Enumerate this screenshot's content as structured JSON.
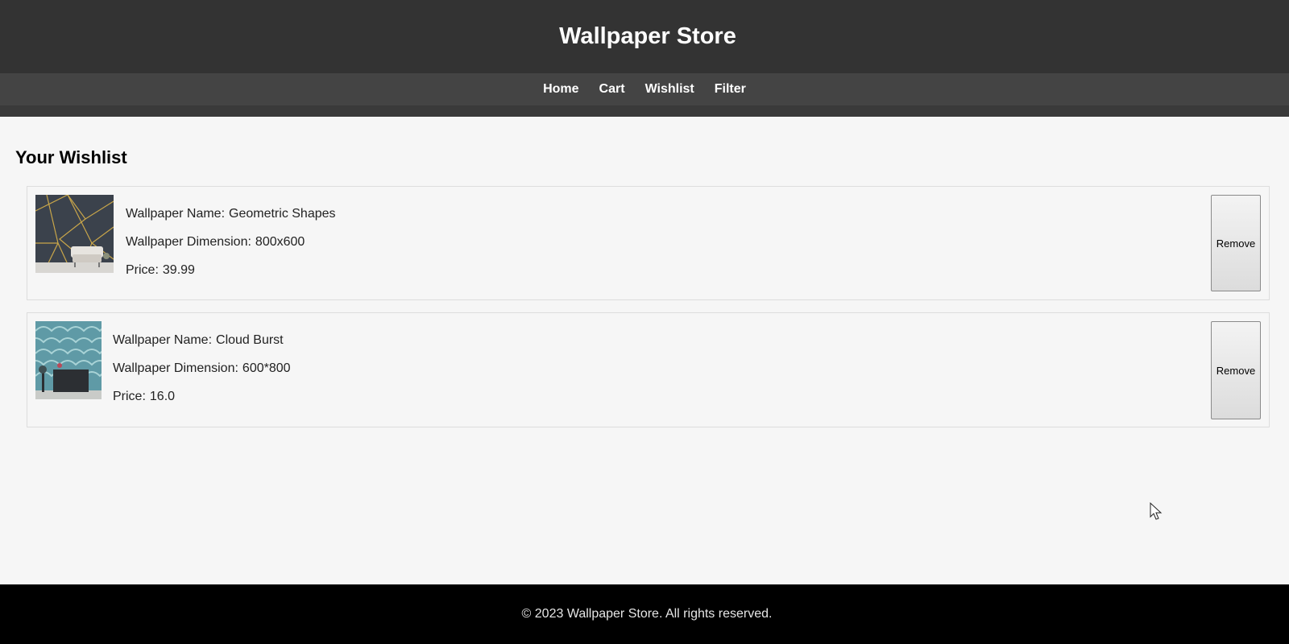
{
  "header": {
    "title": "Wallpaper Store"
  },
  "nav": {
    "items": [
      "Home",
      "Cart",
      "Wishlist",
      "Filter"
    ]
  },
  "wishlist": {
    "heading": "Your Wishlist",
    "items": [
      {
        "name_label": "Wallpaper Name:",
        "name": "Geometric Shapes",
        "dimension_label": "Wallpaper Dimension:",
        "dimension": "800x600",
        "price_label": "Price:",
        "price": "39.99",
        "remove_label": "Remove"
      },
      {
        "name_label": "Wallpaper Name:",
        "name": "Cloud Burst",
        "dimension_label": "Wallpaper Dimension:",
        "dimension": "600*800",
        "price_label": "Price:",
        "price": "16.0",
        "remove_label": "Remove"
      }
    ]
  },
  "footer": {
    "text": "© 2023 Wallpaper Store. All rights reserved."
  },
  "colors": {
    "header_bg": "#333333",
    "nav_bg": "#444444",
    "footer_bg": "#000000",
    "page_bg": "#f6f6f6"
  }
}
